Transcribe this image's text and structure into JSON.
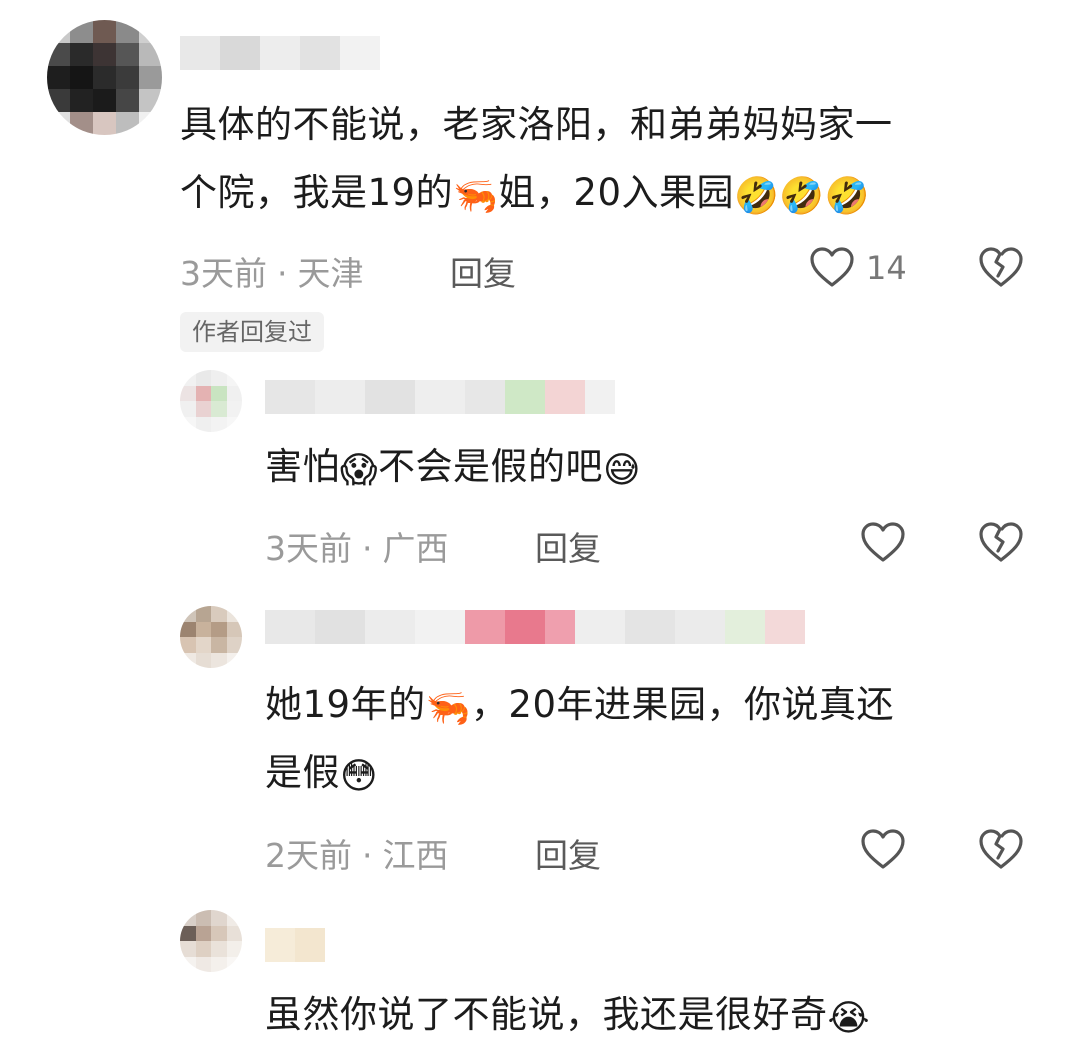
{
  "comments": [
    {
      "text_line1": "具体的不能说，老家洛阳，和弟弟妈妈家一",
      "text_line2_a": "个院，我是19的",
      "shrimp": "🦐",
      "text_line2_b": "姐，20入果园",
      "emojis": "🤣🤣🤣",
      "time": "3天前",
      "location": "天津",
      "reply_label": "回复",
      "like_count": "14",
      "author_replied_tag": "作者回复过"
    },
    {
      "text_a": "害怕",
      "emoji_a": "😱",
      "text_b": "不会是假的吧",
      "emoji_b": "😅",
      "time": "3天前",
      "location": "广西",
      "reply_label": "回复"
    },
    {
      "text_line1_a": "她19年的",
      "shrimp": "🦐",
      "text_line1_b": "，20年进果园，你说真还",
      "text_line2": "是假",
      "emoji": "😳",
      "time": "2天前",
      "location": "江西",
      "reply_label": "回复"
    },
    {
      "text": "虽然你说了不能说，我还是很好奇",
      "emoji": "😭"
    }
  ],
  "meta_separator": "·",
  "colors": {
    "meta": "#9a9a9a",
    "text": "#1c1c1c",
    "tag_bg": "#f2f2f2"
  }
}
